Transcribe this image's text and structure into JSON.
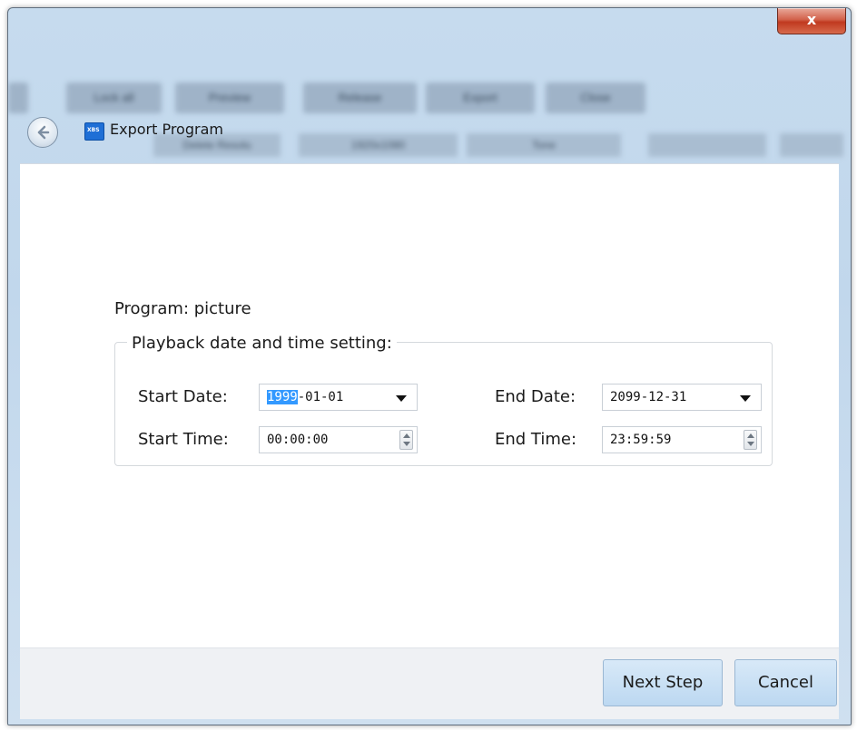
{
  "window": {
    "title": "Export Program",
    "close_label": "x",
    "app_icon_text": "XBS"
  },
  "background_toolbar": {
    "buttons": [
      "Lock all",
      "Preview",
      "Release",
      "Export",
      "Close"
    ],
    "row_cells": [
      "",
      "Delete Resolu",
      "1920x1080",
      "Tone",
      "",
      ""
    ]
  },
  "program": {
    "label": "Program: picture"
  },
  "playback": {
    "legend": "Playback date and time setting:",
    "start_date_label": "Start Date:",
    "start_date_year_selected": "1999",
    "start_date_rest": "-01-01",
    "end_date_label": "End Date:",
    "end_date_value": "2099-12-31",
    "start_time_label": "Start Time:",
    "start_time_value": "00:00:00",
    "end_time_label": "End Time:",
    "end_time_value": "23:59:59"
  },
  "footer": {
    "next_label": "Next Step",
    "cancel_label": "Cancel"
  },
  "colors": {
    "selection": "#3399ff",
    "close_button": "#c0391f",
    "primary_button": "#bcd8f1"
  }
}
